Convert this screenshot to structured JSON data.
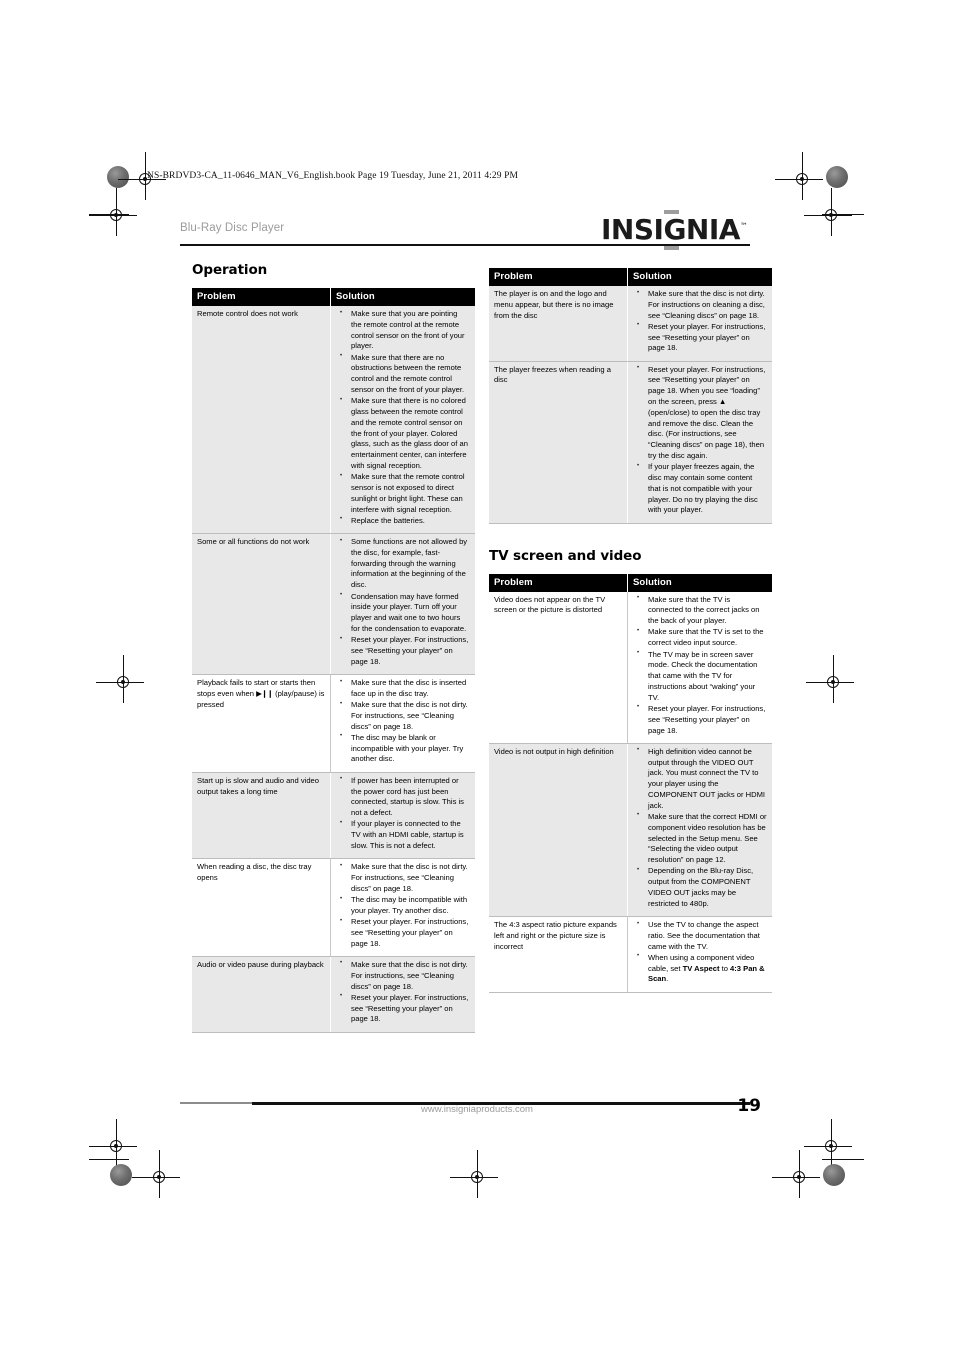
{
  "page": {
    "file_code": "NS-BRDVD3-CA_11-0646_MAN_V6_English.book  Page 19  Tuesday, June 21, 2011  4:29 PM",
    "running_head": "Blu-Ray Disc Player",
    "brand": "INSIGNIA",
    "brand_tm": "™",
    "footer_url": "www.insigniaproducts.com",
    "page_number": "19"
  },
  "table_headers": {
    "problem": "Problem",
    "solution": "Solution"
  },
  "left_column": {
    "section_title": "Operation",
    "rows": [
      {
        "problem": "Remote control does not work",
        "solutions": [
          "Make sure that you are pointing the remote control at the remote control sensor on the front of your player.",
          "Make sure that there are no obstructions between the remote control and the remote control sensor on the front of your player.",
          "Make sure that there is no colored glass between the remote control and the remote control sensor on the front of your player. Colored glass, such as the glass door of an entertainment center, can interfere with signal reception.",
          "Make sure that the remote control sensor is not exposed to direct sunlight or bright light. These can interfere with signal reception.",
          "Replace the batteries."
        ]
      },
      {
        "problem": "Some or all functions do not work",
        "solutions": [
          "Some functions are not allowed by the disc, for example, fast-forwarding through the warning information at the beginning of the disc.",
          "Condensation may have formed inside your player. Turn off your player and wait one to two hours for the condensation to evaporate.",
          "Reset your player. For instructions, see “Resetting your player” on page 18."
        ]
      },
      {
        "problem_pre": "Playback fails to start or starts then stops even when ",
        "problem_icon": "play-pause-icon",
        "problem_post": " (play/pause) is pressed",
        "solutions": [
          "Make sure that the disc is inserted face up in the disc tray.",
          "Make sure that the disc is not dirty. For instructions, see “Cleaning discs” on page 18.",
          "The disc may be blank or incompatible with your player. Try another disc."
        ]
      },
      {
        "problem": "Start up is slow and audio and video output takes a long time",
        "solutions": [
          "If power has been interrupted or the power cord has just been connected, startup is slow. This is not a defect.",
          "If your player is connected to the TV with an HDMI cable, startup is slow. This is not a defect."
        ]
      },
      {
        "problem": "When reading a disc, the disc tray opens",
        "solutions": [
          "Make sure that the disc is not dirty. For instructions, see “Cleaning discs” on page 18.",
          "The disc may be incompatible with your player. Try another disc.",
          "Reset your player. For instructions, see “Resetting your player” on page 18."
        ]
      },
      {
        "problem": "Audio or video pause during playback",
        "solutions": [
          "Make sure that the disc is not dirty. For instructions, see “Cleaning discs” on page 18.",
          "Reset your player. For instructions, see “Resetting your player” on page 18."
        ]
      }
    ]
  },
  "right_column": {
    "table1_rows": [
      {
        "problem": "The player is on and the logo and menu appear, but there is no image from the disc",
        "solutions": [
          "Make sure that the disc is not dirty. For instructions on cleaning a disc, see “Cleaning discs” on page 18.",
          "Reset your player. For instructions, see “Resetting your player” on page 18."
        ]
      },
      {
        "problem": "The player freezes when reading a disc",
        "solutions": [
          "Reset your player. For instructions, see “Resetting your player” on page 18. When you see “loading” on the screen, press ▲ (open/close) to open the disc tray and remove the disc. Clean the disc. (For instructions, see “Cleaning discs” on page 18), then try the disc again.",
          "If your player freezes again, the disc may contain some content that is not compatible with your player. Do no try playing the disc with your player."
        ]
      }
    ],
    "section_title": "TV screen and video",
    "table2_rows": [
      {
        "problem": "Video does not appear on the TV screen or the picture is distorted",
        "solutions": [
          "Make sure that the TV is connected to the correct jacks on the back of your player.",
          "Make sure that the TV is set to the correct video input source.",
          "The TV may be in screen saver mode. Check the documentation that came with the TV for instructions about “waking” your TV.",
          "Reset your player. For instructions, see “Resetting your player” on page 18."
        ]
      },
      {
        "problem": "Video is not output in high definition",
        "solutions": [
          "High definition video cannot be output through the VIDEO OUT jack. You must connect the TV to your player using the COMPONENT OUT jacks or HDMI jack.",
          "Make sure that the correct HDMI or component video resolution has be selected in the Setup menu. See “Selecting the video output resolution” on page 12.",
          "Depending on the Blu-ray Disc, output from the COMPONENT VIDEO OUT jacks may be restricted to 480p."
        ]
      },
      {
        "problem": "The 4:3 aspect ratio picture expands left and right or the picture size is incorrect",
        "solutions_rich": [
          [
            {
              "t": "Use the TV to change the aspect ratio. See the documentation that came with the TV.",
              "b": false
            }
          ],
          [
            {
              "t": "When using a component video cable, set ",
              "b": false
            },
            {
              "t": "TV Aspect",
              "b": true
            },
            {
              "t": " to ",
              "b": false
            },
            {
              "t": "4:3 Pan & Scan",
              "b": true
            },
            {
              "t": ".",
              "b": false
            }
          ]
        ]
      }
    ]
  }
}
